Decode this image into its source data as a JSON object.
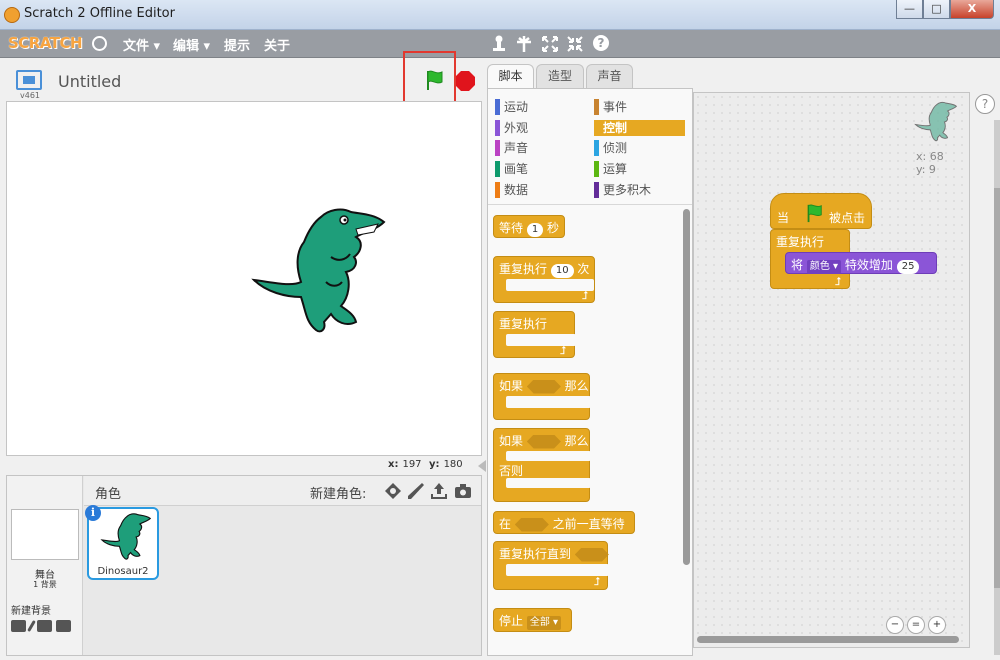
{
  "window": {
    "title": "Scratch 2 Offline Editor",
    "minimize": "—",
    "maximize": "□",
    "close": "X"
  },
  "menubar": {
    "logo": "SCRATCH",
    "file": "文件 ▾",
    "edit": "编辑 ▾",
    "tips": "提示",
    "about": "关于",
    "tools": [
      "duplicate-tool",
      "delete-tool",
      "grow-tool",
      "shrink-tool",
      "help-tool"
    ],
    "help": "?"
  },
  "stage": {
    "version": "v461",
    "project_title": "Untitled",
    "coords": {
      "x_label": "x:",
      "x": "197",
      "y_label": "y:",
      "y": "180"
    }
  },
  "sprite_pane": {
    "sprites_label": "角色",
    "new_sprite_label": "新建角色:",
    "stage_label": "舞台",
    "backdrop_count": "1 背景",
    "new_backdrop_label": "新建背景",
    "sprite_name": "Dinosaur2"
  },
  "tabs": [
    "脚本",
    "造型",
    "声音"
  ],
  "categories": [
    {
      "label": "运动",
      "color": "#4a6cd4"
    },
    {
      "label": "事件",
      "color": "#c88330"
    },
    {
      "label": "外观",
      "color": "#8a55d7"
    },
    {
      "label": "控制",
      "color": "#e6a822",
      "selected": true
    },
    {
      "label": "声音",
      "color": "#bb42c3"
    },
    {
      "label": "侦测",
      "color": "#2ca5e2"
    },
    {
      "label": "画笔",
      "color": "#0e9a6c"
    },
    {
      "label": "运算",
      "color": "#5cb712"
    },
    {
      "label": "数据",
      "color": "#ee7d16"
    },
    {
      "label": "更多积木",
      "color": "#632d99"
    }
  ],
  "blocks": {
    "wait": {
      "pre": "等待",
      "val": "1",
      "post": "秒"
    },
    "repeat": {
      "pre": "重复执行",
      "val": "10",
      "post": "次"
    },
    "forever": "重复执行",
    "if_then": {
      "pre": "如果",
      "post": "那么"
    },
    "if_else": {
      "pre": "如果",
      "post": "那么",
      "else": "否则"
    },
    "wait_until": {
      "pre": "在",
      "post": "之前一直等待"
    },
    "repeat_until": "重复执行直到",
    "stop": {
      "pre": "停止",
      "option": "全部 ▾"
    }
  },
  "script": {
    "hat": {
      "pre": "当",
      "post": "被点击"
    },
    "forever": "重复执行",
    "change_effect": {
      "pre": "将",
      "effect": "颜色 ▾",
      "mid": "特效增加",
      "val": "25"
    },
    "sprite_x": "x: 68",
    "sprite_y": "y: 9"
  },
  "colors": {
    "control": "#e6a822",
    "looks": "#8b55d7",
    "highlight": "#e2382f",
    "flag": "#2eb82e",
    "stop": "#e0141c"
  }
}
